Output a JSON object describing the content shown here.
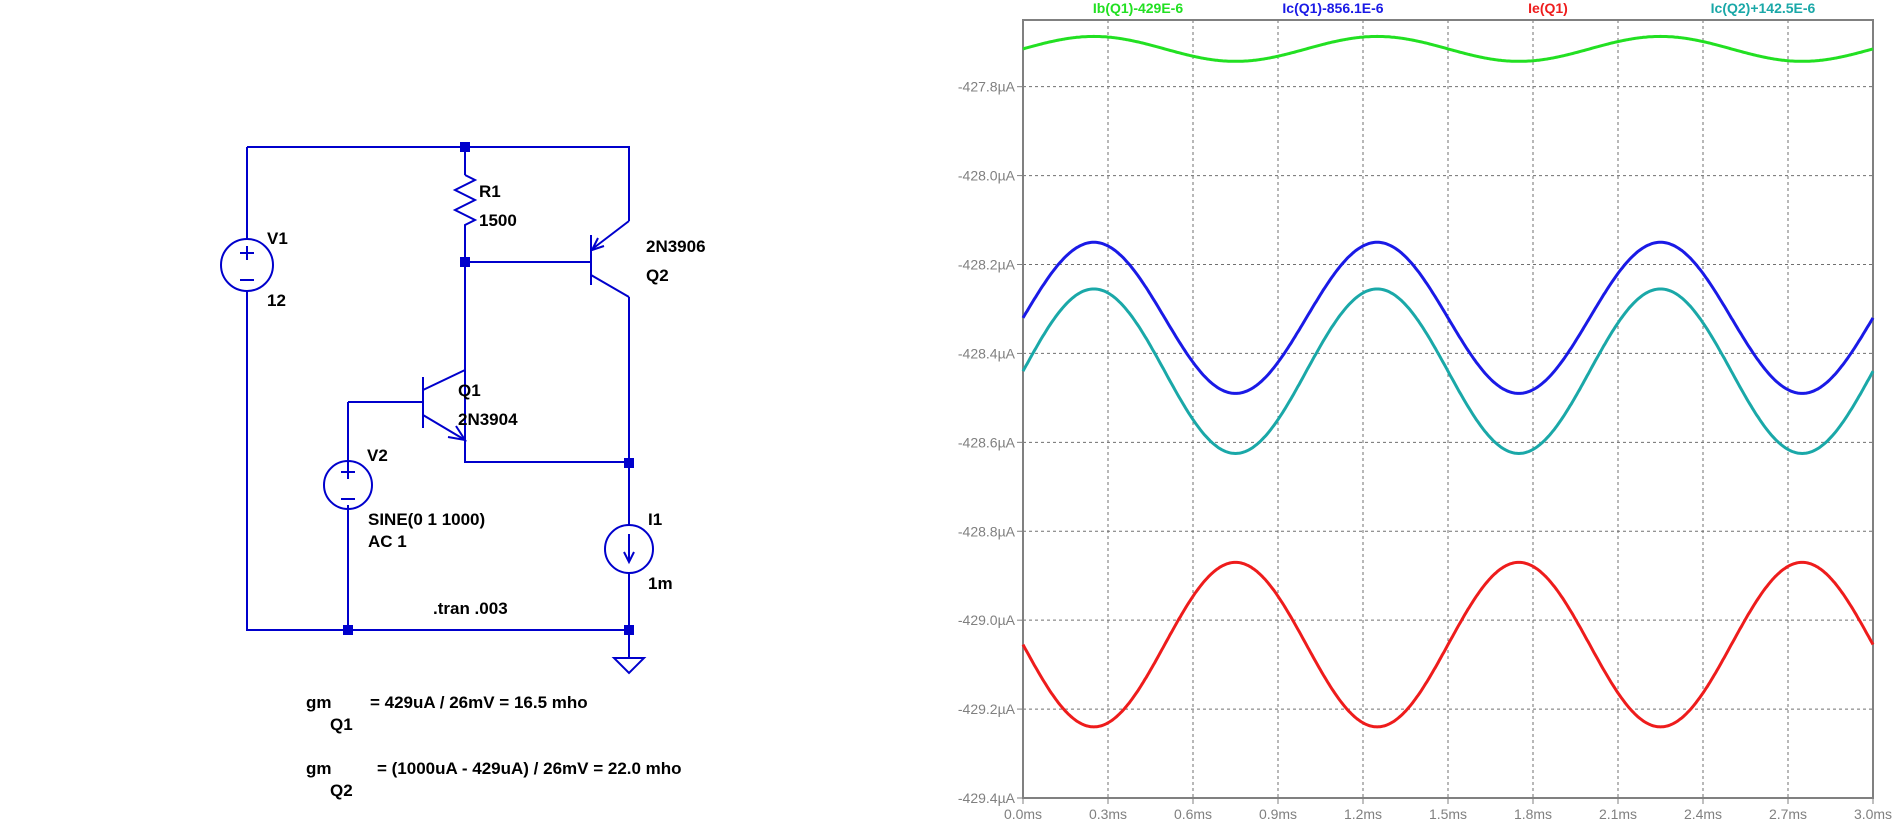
{
  "schematic": {
    "v1_name": "V1",
    "v1_value": "12",
    "r1_name": "R1",
    "r1_value": "1500",
    "q2_model": "2N3906",
    "q2_name": "Q2",
    "q1_name": "Q1",
    "q1_model": "2N3904",
    "v2_name": "V2",
    "v2_value": "SINE(0 1 1000)",
    "v2_ac": "AC 1",
    "i1_name": "I1",
    "i1_value": "1m",
    "directive": ".tran .003",
    "gm1_label": "gm",
    "gm1_sub": "Q1",
    "gm1_expr": "= 429uA / 26mV = 16.5 mho",
    "gm2_label": "gm",
    "gm2_sub": "Q2",
    "gm2_expr": "= (1000uA - 429uA) / 26mV = 22.0 mho"
  },
  "waveform": {
    "legend": [
      "Ib(Q1)-429E-6",
      "Ic(Q1)-856.1E-6",
      "Ie(Q1)",
      "Ic(Q2)+142.5E-6"
    ],
    "y_ticks": [
      "-427.8µA",
      "-428.0µA",
      "-428.2µA",
      "-428.4µA",
      "-428.6µA",
      "-428.8µA",
      "-429.0µA",
      "-429.2µA",
      "-429.4µA"
    ],
    "x_ticks": [
      "0.0ms",
      "0.3ms",
      "0.6ms",
      "0.9ms",
      "1.2ms",
      "1.5ms",
      "1.8ms",
      "2.1ms",
      "2.4ms",
      "2.7ms",
      "3.0ms"
    ]
  },
  "chart_data": {
    "type": "line",
    "xlabel": "",
    "ylabel": "",
    "xlim": [
      0,
      3.0
    ],
    "ylim": [
      -429.4,
      -427.65
    ],
    "x_unit": "ms",
    "y_unit": "µA",
    "series": [
      {
        "name": "Ib(Q1)-429E-6",
        "color": "#22e022",
        "offset": -427.715,
        "amplitude": 0.028,
        "freq_khz": 1.0,
        "phase_deg": 0
      },
      {
        "name": "Ic(Q1)-856.1E-6",
        "color": "#1a1ae6",
        "offset": -428.32,
        "amplitude": 0.17,
        "freq_khz": 1.0,
        "phase_deg": 0
      },
      {
        "name": "Ie(Q1)",
        "color": "#ee1c1c",
        "offset": -429.055,
        "amplitude": 0.185,
        "freq_khz": 1.0,
        "phase_deg": 180
      },
      {
        "name": "Ic(Q2)+142.5E-6",
        "color": "#1aa8a8",
        "offset": -428.44,
        "amplitude": 0.185,
        "freq_khz": 1.0,
        "phase_deg": 0
      }
    ]
  }
}
